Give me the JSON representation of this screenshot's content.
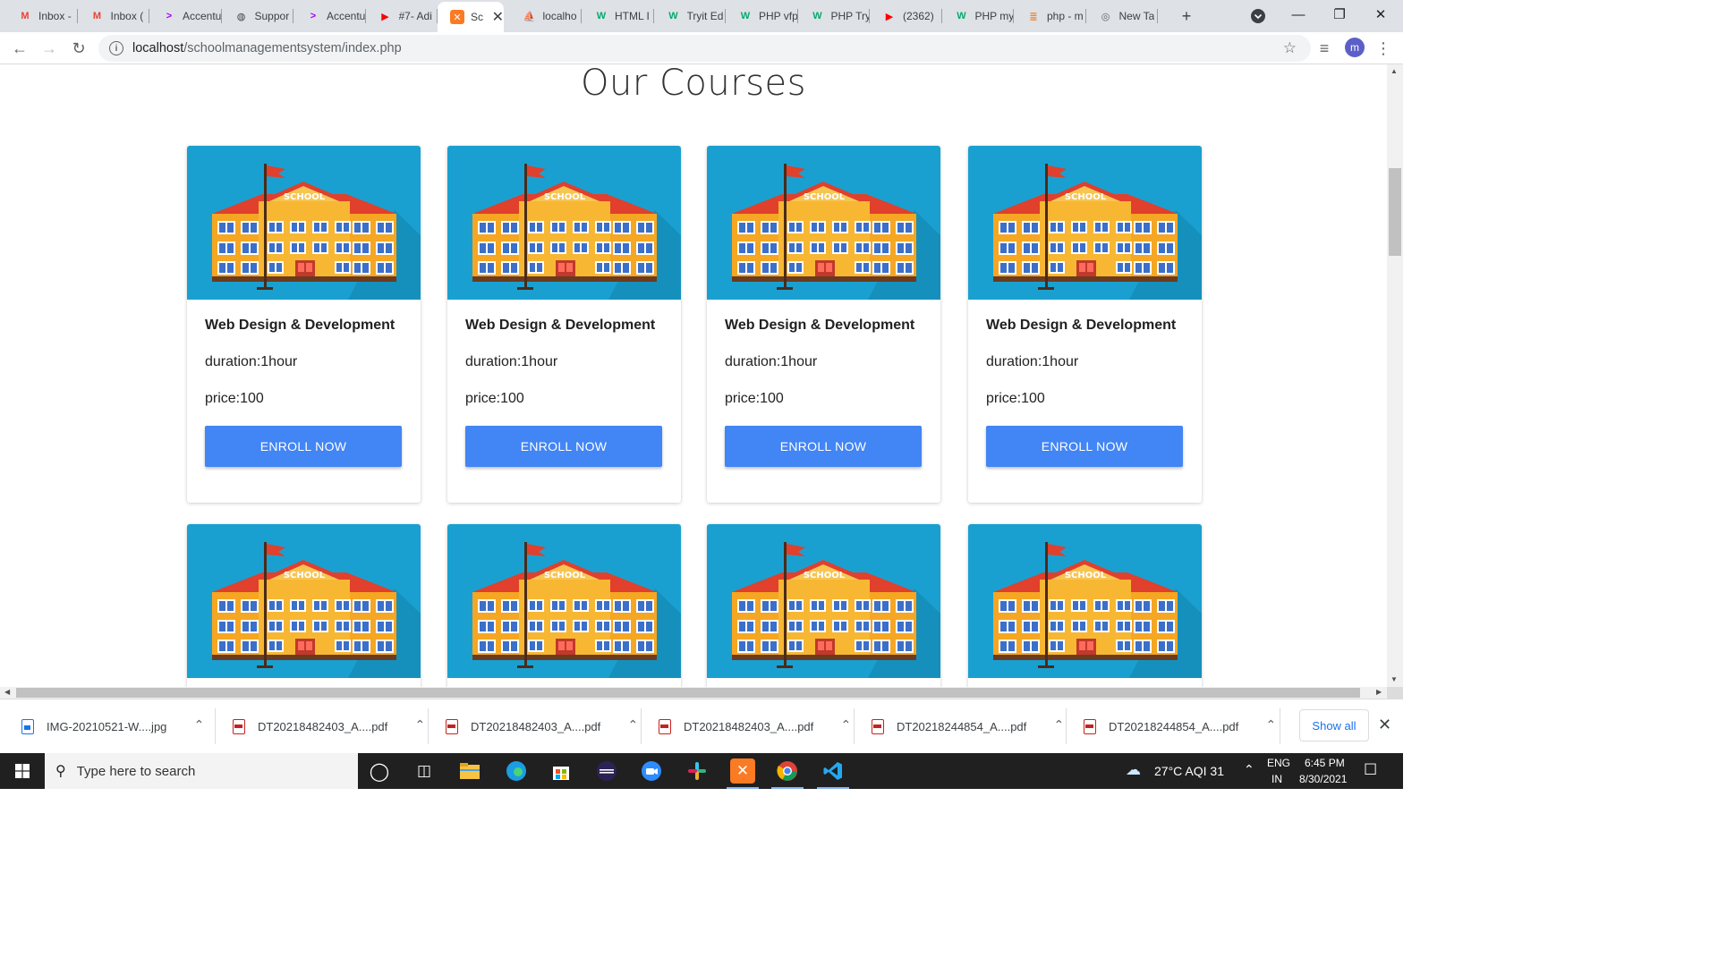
{
  "browser": {
    "tabs": [
      {
        "title": "Inbox -",
        "icon": "gmail-icon",
        "glyph": "M",
        "color": "#ea4335"
      },
      {
        "title": "Inbox (",
        "icon": "gmail-icon",
        "glyph": "M",
        "color": "#ea4335"
      },
      {
        "title": "Accentu",
        "icon": "accenture-icon",
        "glyph": ">",
        "color": "#a100ff"
      },
      {
        "title": "Suppor",
        "icon": "globe-icon",
        "glyph": "◍",
        "color": "#3c4043"
      },
      {
        "title": "Accentu",
        "icon": "accenture-icon",
        "glyph": ">",
        "color": "#a100ff"
      },
      {
        "title": "#7- Adi",
        "icon": "youtube-icon",
        "glyph": "▶",
        "color": "#ff0000"
      },
      {
        "title": "Sch",
        "icon": "xampp-icon",
        "glyph": "✕",
        "color": "#fb7a24",
        "active": true
      },
      {
        "title": "localho",
        "icon": "phpmyadmin-icon",
        "glyph": "⛵",
        "color": "#f89c0e"
      },
      {
        "title": "HTML I",
        "icon": "w3schools-icon",
        "glyph": "W",
        "color": "#04aa6d"
      },
      {
        "title": "Tryit Ed",
        "icon": "w3schools-icon",
        "glyph": "W",
        "color": "#04aa6d"
      },
      {
        "title": "PHP vfp",
        "icon": "w3schools-icon",
        "glyph": "W",
        "color": "#04aa6d"
      },
      {
        "title": "PHP Try",
        "icon": "w3schools-icon",
        "glyph": "W",
        "color": "#04aa6d"
      },
      {
        "title": "(2362)",
        "icon": "youtube-icon",
        "glyph": "▶",
        "color": "#ff0000"
      },
      {
        "title": "PHP my",
        "icon": "w3schools-icon",
        "glyph": "W",
        "color": "#04aa6d"
      },
      {
        "title": "php - m",
        "icon": "stackoverflow-icon",
        "glyph": "≣",
        "color": "#f48024"
      },
      {
        "title": "New Ta",
        "icon": "chrome-icon",
        "glyph": "◎",
        "color": "#5f6368"
      }
    ],
    "new_tab_symbol": "+",
    "url_host": "localhost",
    "url_path": "/schoolmanagementsystem/index.php",
    "avatar_letter": "m"
  },
  "page": {
    "title": "Our Courses",
    "courses": [
      {
        "title": "Web Design & Development",
        "duration": "duration:1hour",
        "price": "price:100",
        "button": "ENROLL NOW"
      },
      {
        "title": "Web Design & Development",
        "duration": "duration:1hour",
        "price": "price:100",
        "button": "ENROLL NOW"
      },
      {
        "title": "Web Design & Development",
        "duration": "duration:1hour",
        "price": "price:100",
        "button": "ENROLL NOW"
      },
      {
        "title": "Web Design & Development",
        "duration": "duration:1hour",
        "price": "price:100",
        "button": "ENROLL NOW"
      },
      {
        "title": "",
        "duration": "",
        "price": "",
        "button": ""
      },
      {
        "title": "",
        "duration": "",
        "price": "",
        "button": ""
      },
      {
        "title": "",
        "duration": "",
        "price": "",
        "button": ""
      },
      {
        "title": "",
        "duration": "",
        "price": "",
        "button": ""
      }
    ],
    "image_sign_text": "SCHOOL"
  },
  "colors": {
    "accent_button": "#4285f4",
    "image_sky": "#1aa0d0",
    "building_wall": "#f5a623",
    "roof": "#e0402c"
  },
  "downloads": {
    "files": [
      {
        "name": "IMG-20210521-W....jpg",
        "type": "image"
      },
      {
        "name": "DT20218482403_A....pdf",
        "type": "pdf"
      },
      {
        "name": "DT20218482403_A....pdf",
        "type": "pdf"
      },
      {
        "name": "DT20218482403_A....pdf",
        "type": "pdf"
      },
      {
        "name": "DT20218244854_A....pdf",
        "type": "pdf"
      },
      {
        "name": "DT20218244854_A....pdf",
        "type": "pdf"
      }
    ],
    "show_all": "Show all"
  },
  "taskbar": {
    "search_placeholder": "Type here to search",
    "weather": "27°C  AQI 31",
    "language": "ENG",
    "region": "IN",
    "time": "6:45 PM",
    "date": "8/30/2021"
  }
}
